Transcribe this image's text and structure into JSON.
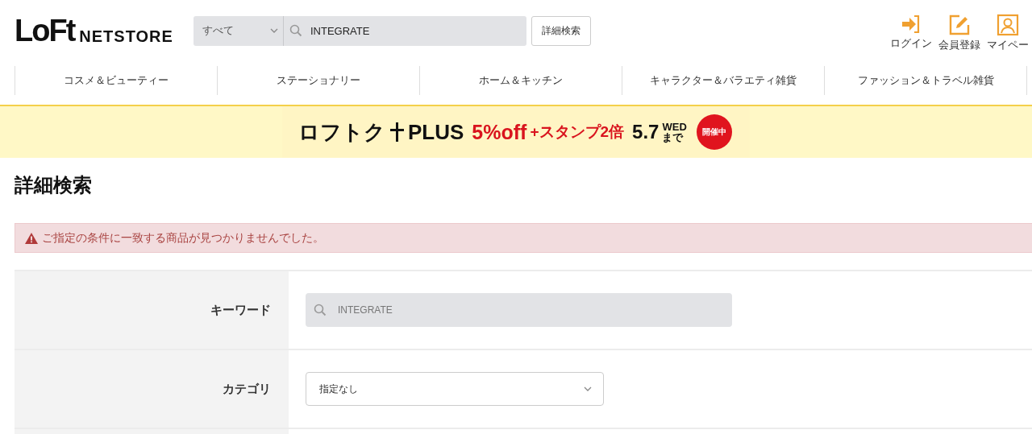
{
  "header": {
    "logo_main": "LoFt",
    "logo_sub": "NETSTORE",
    "search_scope": "すべて",
    "search_value": "INTEGRATE",
    "advanced_button": "詳細検索",
    "user_links": [
      {
        "kind": "login",
        "label": "ログイン"
      },
      {
        "kind": "register",
        "label": "会員登録"
      },
      {
        "kind": "mypage",
        "label": "マイペー"
      }
    ]
  },
  "nav": [
    {
      "label": "コスメ＆ビューティー"
    },
    {
      "label": "ステーショナリー"
    },
    {
      "label": "ホーム＆キッチン"
    },
    {
      "label": "キャラクター＆バラエティ雑貨"
    },
    {
      "label": "ファッション＆トラベル雑貨"
    }
  ],
  "banner": {
    "brand": "ロフトク",
    "plus": "PLUS",
    "offer": "5%off",
    "stamp": "+スタンプ2倍",
    "date": "5.7",
    "weekday": "WED",
    "until": "まで",
    "badge": "開催中"
  },
  "page_title": "詳細検索",
  "alert": "ご指定の条件に一致する商品が見つかりませんでした。",
  "form": [
    {
      "kind": "search",
      "label": "キーワード",
      "value": "INTEGRATE"
    },
    {
      "kind": "select",
      "label": "カテゴリ",
      "value": "指定なし"
    },
    {
      "kind": "empty"
    }
  ]
}
